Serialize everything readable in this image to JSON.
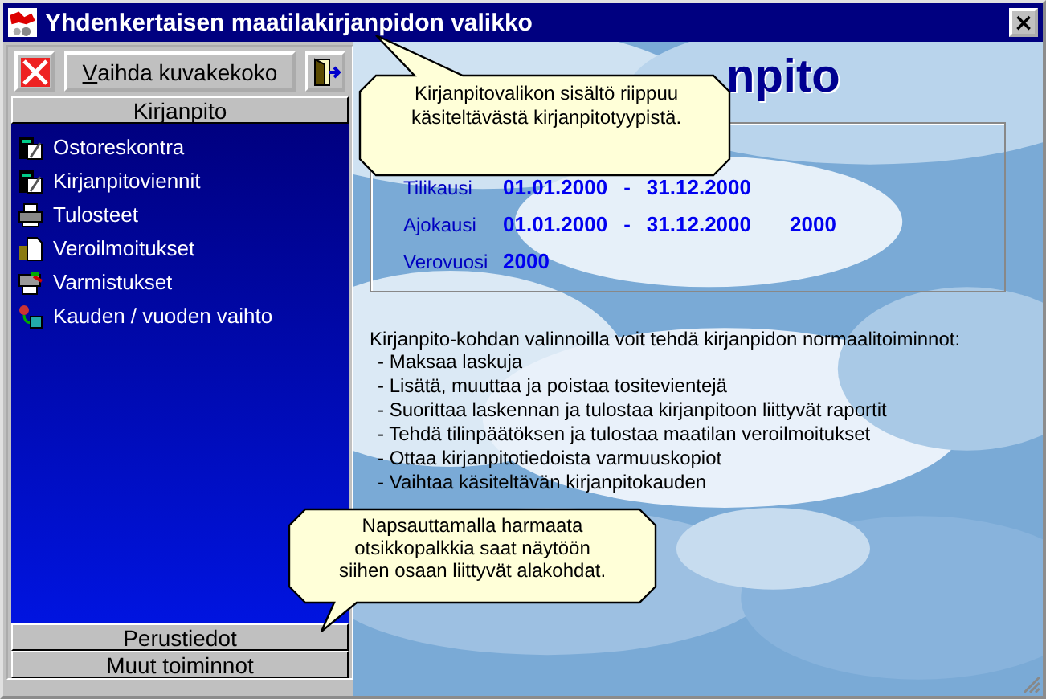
{
  "window": {
    "title": "Yhdenkertaisen maatilakirjanpidon valikko",
    "close": "×"
  },
  "toolbar": {
    "resize_button": "Vaihda kuvakekoko"
  },
  "sections": [
    {
      "label": "Kirjanpito",
      "expanded": true,
      "items": [
        {
          "label": "Ostoreskontra",
          "kind": "ledger"
        },
        {
          "label": "Kirjanpitoviennit",
          "kind": "ledger"
        },
        {
          "label": "Tulosteet",
          "kind": "printer"
        },
        {
          "label": "Veroilmoitukset",
          "kind": "document"
        },
        {
          "label": "Varmistukset",
          "kind": "backup"
        },
        {
          "label": "Kauden / vuoden vaihto",
          "kind": "switch"
        }
      ]
    },
    {
      "label": "Perustiedot",
      "expanded": false
    },
    {
      "label": "Muut toiminnot",
      "expanded": false
    }
  ],
  "main": {
    "title": "npito",
    "periods": [
      {
        "label": "Tilikausi",
        "start": "01.01.2000",
        "separator": "-",
        "end": "31.12.2000"
      },
      {
        "label": "Ajokausi",
        "start": "01.01.2000",
        "separator": "-",
        "end": "31.12.2000",
        "year": "2000"
      },
      {
        "label": "Verovuosi",
        "year": "2000"
      }
    ],
    "intro": "Kirjanpito-kohdan valinnoilla voit tehdä kirjanpidon normaalitoiminnot:",
    "bullets": [
      "- Maksaa laskuja",
      "- Lisätä, muuttaa ja poistaa tositevientejä",
      "- Suorittaa laskennan ja tulostaa kirjanpitoon liittyvät raportit",
      "- Tehdä tilinpäätöksen ja tulostaa maatilan veroilmoitukset",
      "- Ottaa kirjanpitotiedoista varmuuskopiot",
      "- Vaihtaa käsiteltävän kirjanpitokauden"
    ]
  },
  "callouts": [
    {
      "text": "Kirjanpitovalikon sisältö riippuu käsiteltävästä kirjanpitotyypistä.",
      "kind": "up"
    },
    {
      "text": "Napsauttamalla harmaata otsikkopalkkia saat näytöön siihen osaan liittyvät alakohdat.",
      "kind": "down"
    }
  ]
}
